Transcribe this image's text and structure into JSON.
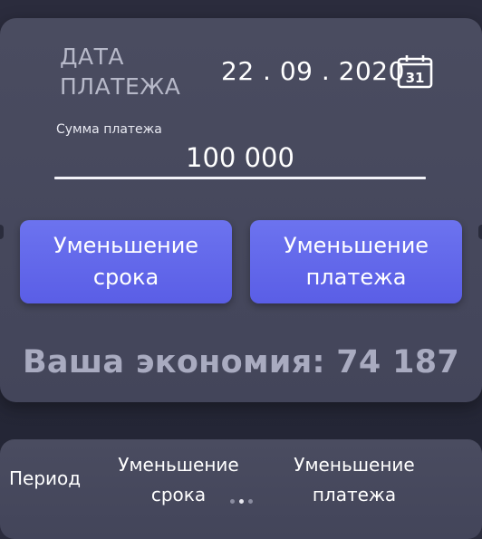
{
  "date_section": {
    "label_line1": "ДАТА",
    "label_line2": "ПЛАТЕЖА",
    "date_value": "22 . 09 . 2020",
    "calendar_icon_text": "31"
  },
  "amount": {
    "label": "Сумма платежа",
    "value": "100 000"
  },
  "buttons": {
    "reduce_term_line1": "Уменьшение",
    "reduce_term_line2": "срока",
    "reduce_payment_line1": "Уменьшение",
    "reduce_payment_line2": "платежа"
  },
  "savings_text": "Ваша экономия: 74 187",
  "table_header": {
    "period": "Период",
    "term_line1": "Уменьшение",
    "term_line2": "срока",
    "payment_line1": "Уменьшение",
    "payment_line2": "платежа"
  },
  "pager": {
    "total": 3,
    "active_index": 1
  },
  "colors": {
    "accent": "#5f65ea",
    "card": "#474a5e",
    "background": "#2a2c3c"
  }
}
